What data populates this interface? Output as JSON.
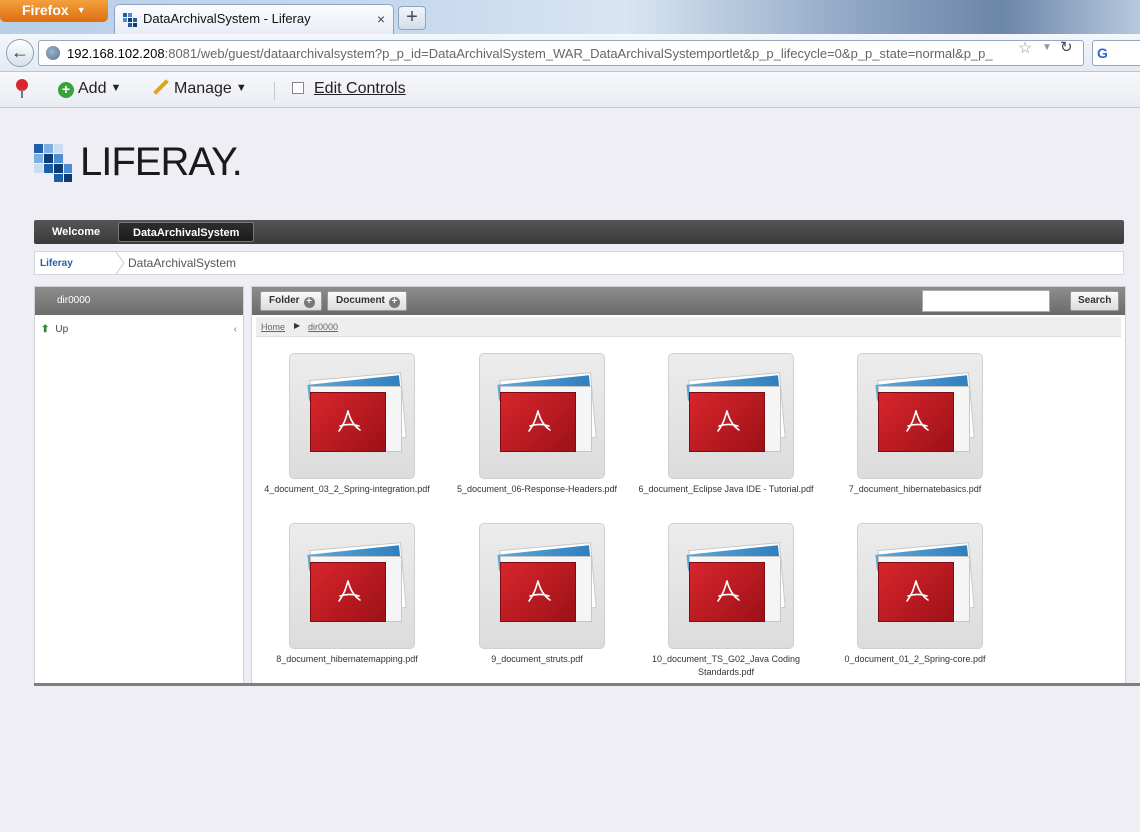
{
  "browser": {
    "app_button": "Firefox",
    "tab_title": "DataArchivalSystem - Liferay",
    "url_host": "192.168.102.208",
    "url_rest": ":8081/web/guest/dataarchivalsystem?p_p_id=DataArchivalSystem_WAR_DataArchivalSystemportlet&p_p_lifecycle=0&p_p_state=normal&p_p_",
    "search_engine_letter": "G"
  },
  "dockbar": {
    "add_label": "Add",
    "manage_label": "Manage",
    "edit_controls_label": "Edit Controls"
  },
  "logo": {
    "text": "LIFERAY."
  },
  "nav": {
    "items": [
      "Welcome",
      "DataArchivalSystem"
    ]
  },
  "breadcrumb": {
    "root": "Liferay",
    "current": "DataArchivalSystem"
  },
  "left": {
    "header": "dir0000",
    "up_label": "Up",
    "collapse": "‹"
  },
  "toolbar": {
    "folder_label": "Folder",
    "document_label": "Document",
    "search_label": "Search",
    "search_value": ""
  },
  "path": {
    "home": "Home",
    "dir": "dir0000"
  },
  "files": [
    "4_document_03_2_Spring-integration.pdf",
    "5_document_06-Response-Headers.pdf",
    "6_document_Eclipse Java IDE - Tutorial.pdf",
    "7_document_hibernatebasics.pdf",
    "8_document_hibernatemapping.pdf",
    "9_document_struts.pdf",
    "10_document_TS_G02_Java Coding Standards.pdf",
    "0_document_01_2_Spring-core.pdf"
  ],
  "colors": {
    "pdf_red": "#c41c22",
    "nav_dark": "#3a3a3a",
    "link_blue": "#2461a8"
  }
}
